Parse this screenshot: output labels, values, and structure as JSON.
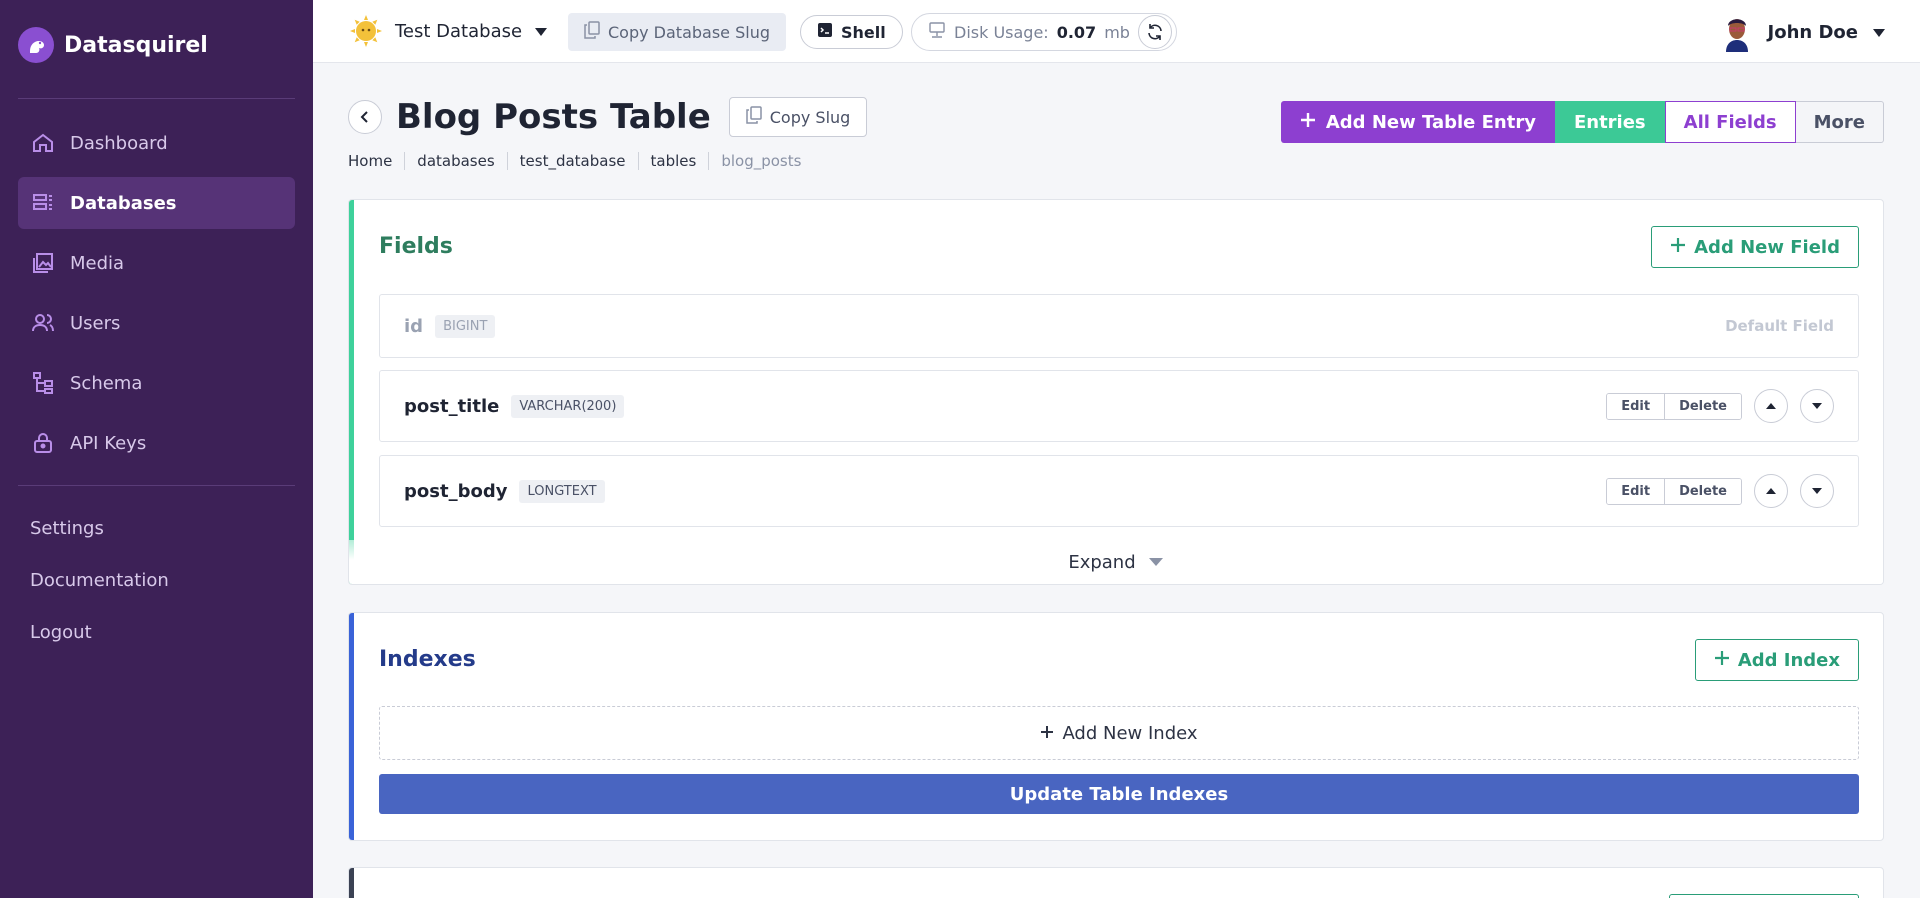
{
  "app": {
    "name": "Datasquirel"
  },
  "sidebar": {
    "items": [
      {
        "label": "Dashboard",
        "icon": "home-icon"
      },
      {
        "label": "Databases",
        "icon": "database-icon",
        "active": true
      },
      {
        "label": "Media",
        "icon": "image-icon"
      },
      {
        "label": "Users",
        "icon": "users-icon"
      },
      {
        "label": "Schema",
        "icon": "schema-icon"
      },
      {
        "label": "API Keys",
        "icon": "lock-icon"
      }
    ],
    "secondary": [
      "Settings",
      "Documentation",
      "Logout"
    ]
  },
  "topbar": {
    "database_name": "Test Database",
    "copy_db_slug": "Copy Database Slug",
    "shell": "Shell",
    "disk_label": "Disk Usage:",
    "disk_value": "0.07",
    "disk_unit": "mb",
    "user_name": "John Doe"
  },
  "page": {
    "title": "Blog Posts Table",
    "copy_slug": "Copy Slug",
    "breadcrumbs": [
      "Home",
      "databases",
      "test_database",
      "tables",
      "blog_posts"
    ],
    "actions": {
      "add_entry": "Add New Table Entry",
      "entries": "Entries",
      "all_fields": "All Fields",
      "more": "More"
    }
  },
  "fields_card": {
    "title": "Fields",
    "add_button": "Add New Field",
    "rows": [
      {
        "name": "id",
        "type": "BIGINT",
        "note": "Default Field"
      },
      {
        "name": "post_title",
        "type": "VARCHAR(200)",
        "edit": "Edit",
        "delete": "Delete"
      },
      {
        "name": "post_body",
        "type": "LONGTEXT",
        "edit": "Edit",
        "delete": "Delete"
      }
    ],
    "expand": "Expand"
  },
  "indexes_card": {
    "title": "Indexes",
    "add_button": "Add Index",
    "add_new": "Add New Index",
    "update": "Update Table Indexes"
  },
  "colors": {
    "sidebar_bg": "#3d2157",
    "accent_purple": "#8d3fd0",
    "accent_green": "#3cc996",
    "fields_accent": "#3ed19b",
    "indexes_accent": "#3a63d8",
    "update_button": "#4965c1"
  }
}
